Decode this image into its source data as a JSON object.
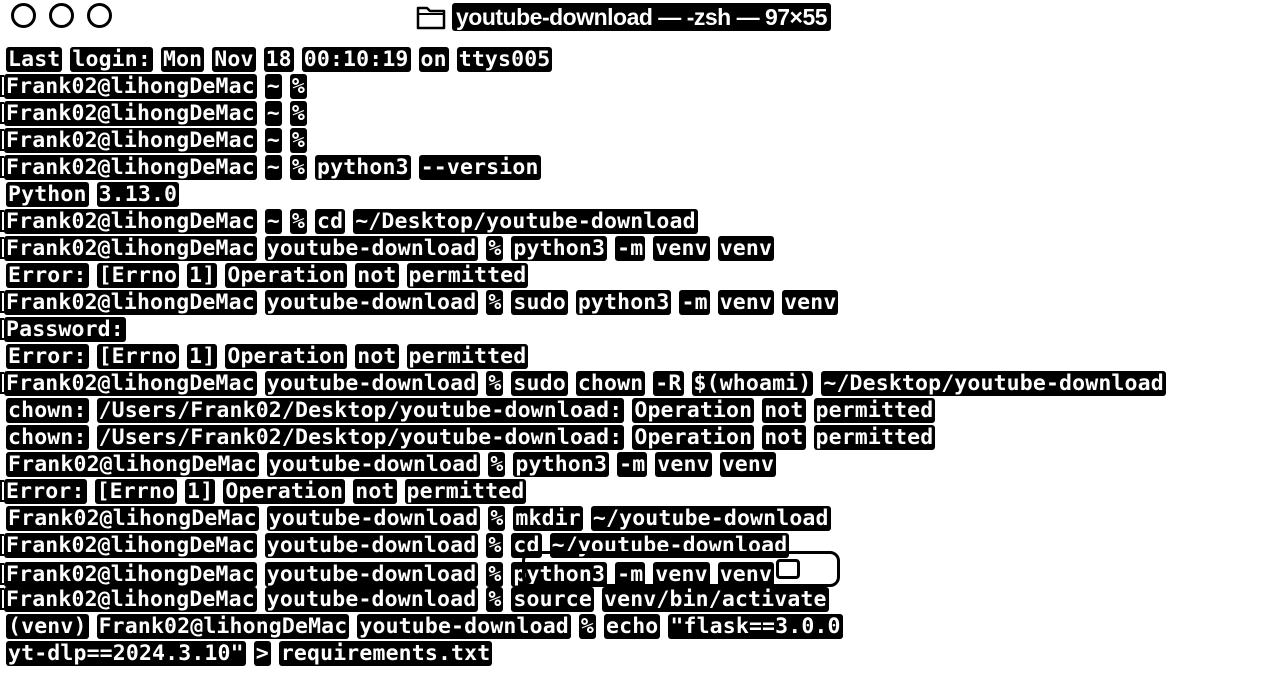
{
  "window": {
    "title": "youtube-download — -zsh — 97×55"
  },
  "terminal": {
    "lines": [
      {
        "bracket": false,
        "tokens": [
          "Last",
          "login:",
          "Mon",
          "Nov",
          "18",
          "00:10:19",
          "on",
          "ttys005"
        ]
      },
      {
        "bracket": true,
        "tokens": [
          "Frank02@lihongDeMac",
          "~",
          "%"
        ]
      },
      {
        "bracket": true,
        "tokens": [
          "Frank02@lihongDeMac",
          "~",
          "%"
        ]
      },
      {
        "bracket": true,
        "tokens": [
          "Frank02@lihongDeMac",
          "~",
          "%"
        ]
      },
      {
        "bracket": true,
        "tokens": [
          "Frank02@lihongDeMac",
          "~",
          "%",
          "python3",
          "--version"
        ]
      },
      {
        "bracket": false,
        "tokens": [
          "Python",
          "3.13.0"
        ]
      },
      {
        "bracket": true,
        "tokens": [
          "Frank02@lihongDeMac",
          "~",
          "%",
          "cd",
          "~/Desktop/youtube-download"
        ]
      },
      {
        "bracket": true,
        "tokens": [
          "Frank02@lihongDeMac",
          "youtube-download",
          "%",
          "python3",
          "-m",
          "venv",
          "venv"
        ]
      },
      {
        "bracket": false,
        "tokens": [
          "Error:",
          "[Errno",
          "1]",
          "Operation",
          "not",
          "permitted"
        ]
      },
      {
        "bracket": true,
        "tokens": [
          "Frank02@lihongDeMac",
          "youtube-download",
          "%",
          "sudo",
          "python3",
          "-m",
          "venv",
          "venv"
        ]
      },
      {
        "bracket": true,
        "tokens": [
          "Password:"
        ]
      },
      {
        "bracket": false,
        "tokens": [
          "Error:",
          "[Errno",
          "1]",
          "Operation",
          "not",
          "permitted"
        ]
      },
      {
        "bracket": true,
        "tokens": [
          "Frank02@lihongDeMac",
          "youtube-download",
          "%",
          "sudo",
          "chown",
          "-R",
          "$(whoami)",
          "~/Desktop/youtube-download"
        ]
      },
      {
        "bracket": false,
        "tokens": [
          "chown:",
          "/Users/Frank02/Desktop/youtube-download:",
          "Operation",
          "not",
          "permitted"
        ]
      },
      {
        "bracket": false,
        "tokens": [
          "chown:",
          "/Users/Frank02/Desktop/youtube-download:",
          "Operation",
          "not",
          "permitted"
        ]
      },
      {
        "bracket": false,
        "tokens": [
          "Frank02@lihongDeMac",
          "youtube-download",
          "%",
          "python3",
          "-m",
          "venv",
          "venv"
        ]
      },
      {
        "bracket": true,
        "tokens": [
          "Error:",
          "[Errno",
          "1]",
          "Operation",
          "not",
          "permitted"
        ]
      },
      {
        "bracket": false,
        "tokens": [
          "Frank02@lihongDeMac",
          "youtube-download",
          "%",
          "mkdir",
          "~/youtube-download"
        ]
      },
      {
        "bracket": true,
        "tokens": [
          "Frank02@lihongDeMac",
          "youtube-download",
          "%",
          "cd",
          "~/youtube-download"
        ]
      },
      {
        "bracket": true,
        "tokens": [
          "Frank02@lihongDeMac",
          "youtube-download",
          "%",
          "python3",
          "-m",
          "venv",
          "venv"
        ],
        "highlight": true
      },
      {
        "bracket": true,
        "tokens": [
          "Frank02@lihongDeMac",
          "youtube-download",
          "%",
          "source",
          "venv/bin/activate"
        ]
      },
      {
        "bracket": false,
        "tokens": [
          "(venv)",
          "Frank02@lihongDeMac",
          "youtube-download",
          "%",
          "echo",
          "\"flask==3.0.0"
        ]
      },
      {
        "bracket": false,
        "tokens": [
          "yt-dlp==2024.3.10\"",
          ">",
          "requirements.txt"
        ]
      }
    ]
  }
}
